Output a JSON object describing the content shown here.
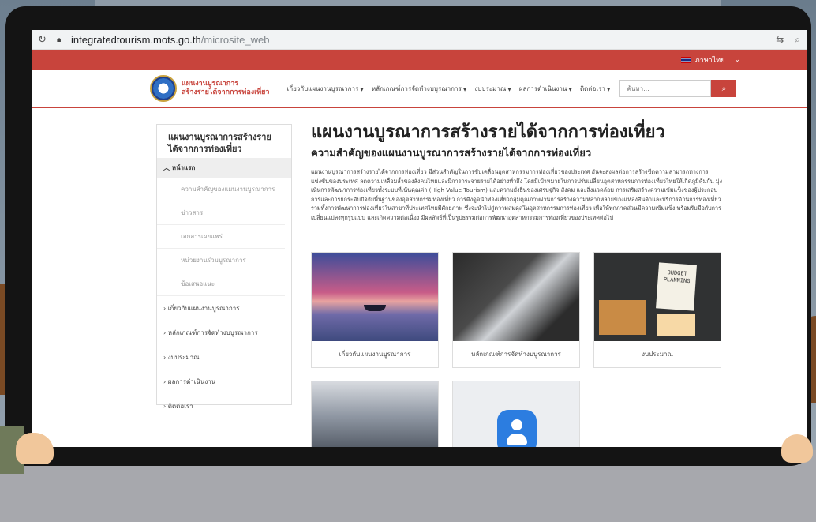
{
  "browser": {
    "host": "integratedtourism.mots.go.th",
    "path": "/microsite_web"
  },
  "topbar": {
    "language": "ภาษาไทย"
  },
  "logo": {
    "line1": "แผนงานบูรณาการ",
    "line2": "สร้างรายได้จากการท่องเที่ยว"
  },
  "nav": {
    "items": [
      "เกี่ยวกับแผนงานบูรณาการ",
      "หลักเกณฑ์การจัดทำงบบูรณาการ",
      "งบประมาณ",
      "ผลการดำเนินงาน",
      "ติดต่อเรา"
    ],
    "search_placeholder": "ค้นหา..."
  },
  "sidebar": {
    "title": "แผนงานบูรณาการสร้างรายได้จากการท่องเที่ยว",
    "home": "หน้าแรก",
    "subitems": [
      "ความสำคัญของแผนงานบูรณาการ",
      "ข่าวสาร",
      "เอกสารเผยแพร่",
      "หน่วยงานร่วมบูรณาการ",
      "ข้อเสนอแนะ"
    ],
    "items": [
      "เกี่ยวกับแผนงานบูรณาการ",
      "หลักเกณฑ์การจัดทำงบบูรณาการ",
      "งบประมาณ",
      "ผลการดำเนินงาน",
      "ติดต่อเรา"
    ]
  },
  "main": {
    "title": "แผนงานบูรณาการสร้างรายได้จากการท่องเที่ยว",
    "subtitle": "ความสำคัญของแผนงานบูรณาการสร้างรายได้จากการท่องเที่ยว",
    "paragraph": "แผนงานบูรณาการสร้างรายได้จากการท่องเที่ยว มีส่วนสำคัญในการขับเคลื่อนอุตสาหกรรมการท่องเที่ยวของประเทศ อันจะส่งผลต่อการสร้างขีดความสามารถทางการแข่งขันของประเทศ ลดความเหลื่อมล้ำของสังคมไทยและมีการกระจายรายได้อย่างทั่วถึง โดยมีเป้าหมายในการปรับเปลี่ยนอุตสาหกรรมการท่องเที่ยวไทยให้เกิดภูมิคุ้มกัน มุ่งเน้นการพัฒนาการท่องเที่ยวทั้งระบบที่เน้นคุณค่า (High Value Tourism) และความยั่งยืนของเศรษฐกิจ สังคม และสิ่งแวดล้อม การเสริมสร้างความเข้มแข็งของผู้ประกอบการและการยกระดับปัจจัยพื้นฐานของอุตสาหกรรมท่องเที่ยว การดึงดูดนักท่องเที่ยวกลุ่มคุณภาพผ่านการสร้างความหลากหลายของแหล่งสินค้าและบริการด้านการท่องเที่ยว รวมทั้งการพัฒนาการท่องเที่ยวในสาขาที่ประเทศไทยมีศักยภาพ ซึ่งจะนำไปสู่ความสมดุลในอุตสาหกรรมการท่องเที่ยว เพื่อให้ทุกภาคส่วนมีความเข้มแข็ง พร้อมรับมือกับการเปลี่ยนแปลงทุกรูปแบบ และเกิดความต่อเนื่อง มีผลลัพธ์ที่เป็นรูปธรรมต่อการพัฒนาอุตสาหกรรมการท่องเที่ยวของประเทศต่อไป"
  },
  "cards": [
    {
      "caption": "เกี่ยวกับแผนงานบูรณาการ"
    },
    {
      "caption": "หลักเกณฑ์การจัดทำงบบูรณาการ"
    },
    {
      "caption": "งบประมาณ"
    }
  ],
  "budget_note": "BUDGET PLANNING"
}
